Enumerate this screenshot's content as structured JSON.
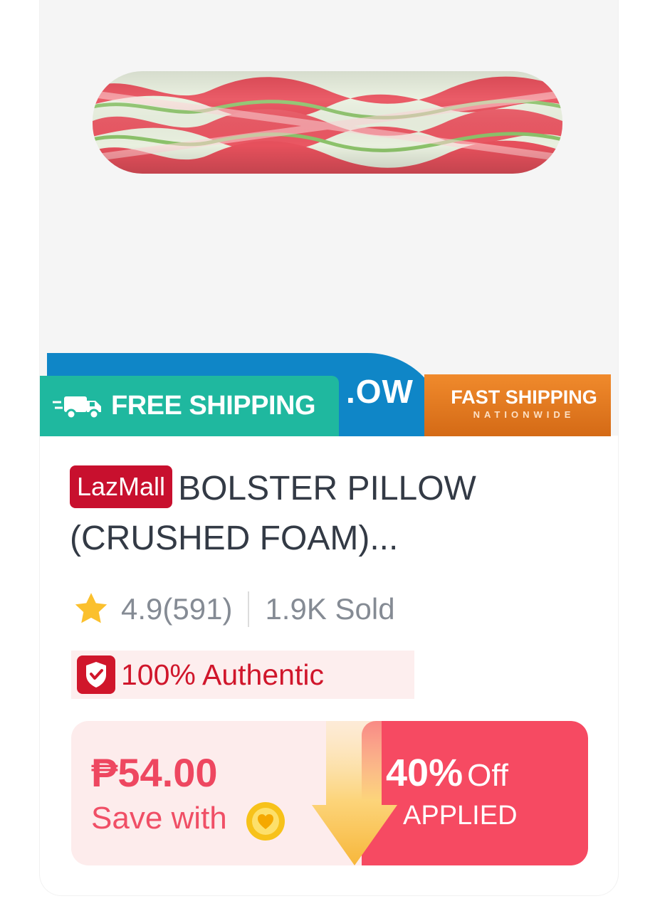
{
  "banner": {
    "partial_text": ".OW",
    "fast_shipping": "FAST SHIPPING",
    "nationwide": "NATIONWIDE",
    "free_shipping": "FREE SHIPPING"
  },
  "product": {
    "badge": "LazMall",
    "title": "BOLSTER PILLOW (CRUSHED FOAM)...",
    "rating": "4.9(591)",
    "sold": "1.9K Sold",
    "authentic_tag": "100% Authentic"
  },
  "price": {
    "current": "₱54.00",
    "save_with": "Save with"
  },
  "discount": {
    "percent": "40%",
    "off": "Off",
    "applied": "APPLIED"
  },
  "colors": {
    "lazmall_red": "#c8102e",
    "price_pink": "#ee4760",
    "discount_bg": "#f64a62",
    "free_ship_teal": "#1fb89f",
    "banner_blue": "#0f86c7",
    "banner_orange": "#f08a2c"
  },
  "icons": {
    "pillow": "product-image",
    "truck": "truck-icon",
    "star": "star-icon",
    "shield": "shield-check-icon",
    "coin": "coin-icon",
    "arrow": "arrow-down-icon"
  }
}
